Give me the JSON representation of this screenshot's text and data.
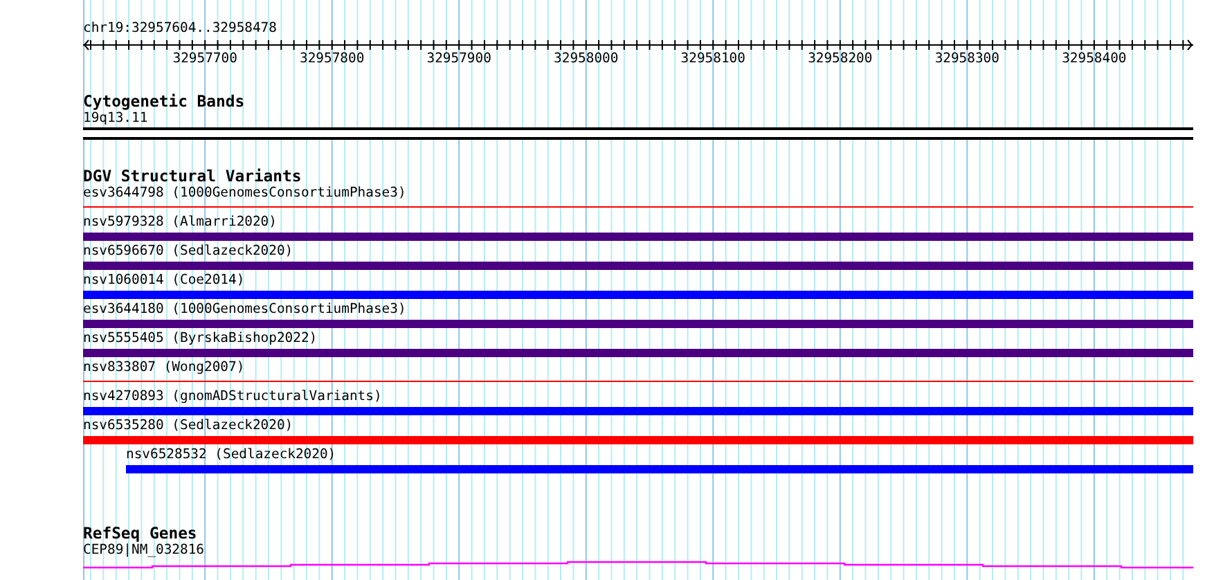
{
  "location": "chr19:32957604..32958478",
  "ruler": {
    "ticks": [
      "32957700",
      "32957800",
      "32957900",
      "32958000",
      "32958100",
      "32958200",
      "32958300",
      "32958400"
    ]
  },
  "tracks": [
    {
      "kind": "cytoband",
      "title": "Cytogenetic Bands",
      "features": [
        {
          "label": "19q13.11"
        }
      ]
    },
    {
      "kind": "variants",
      "title": "DGV Structural Variants",
      "features": [
        {
          "label": "esv3644798 (1000GenomesConsortiumPhase3)",
          "kind": "line",
          "color": "#ff0000",
          "starts_in_view": false
        },
        {
          "label": "nsv5979328 (Almarri2020)",
          "kind": "bar",
          "color": "#4b0082",
          "starts_in_view": false
        },
        {
          "label": "nsv6596670 (Sedlazeck2020)",
          "kind": "bar",
          "color": "#4b0082",
          "starts_in_view": false
        },
        {
          "label": "nsv1060014 (Coe2014)",
          "kind": "bar",
          "color": "#0000ff",
          "starts_in_view": false
        },
        {
          "label": "esv3644180 (1000GenomesConsortiumPhase3)",
          "kind": "bar",
          "color": "#4b0082",
          "starts_in_view": false
        },
        {
          "label": "nsv5555405 (ByrskaBishop2022)",
          "kind": "bar",
          "color": "#4b0082",
          "starts_in_view": false
        },
        {
          "label": "nsv833807 (Wong2007)",
          "kind": "line",
          "color": "#ff0000",
          "starts_in_view": false
        },
        {
          "label": "nsv4270893 (gnomADStructuralVariants)",
          "kind": "bar",
          "color": "#0000ff",
          "starts_in_view": false
        },
        {
          "label": "nsv6535280 (Sedlazeck2020)",
          "kind": "bar",
          "color": "#ff0000",
          "starts_in_view": false
        },
        {
          "label": "nsv6528532 (Sedlazeck2020)",
          "kind": "bar",
          "color": "#0000ff",
          "starts_in_view": true
        }
      ]
    },
    {
      "kind": "genes",
      "title": "RefSeq Genes",
      "features": [
        {
          "label": "CEP89|NM_032816"
        }
      ]
    }
  ]
}
